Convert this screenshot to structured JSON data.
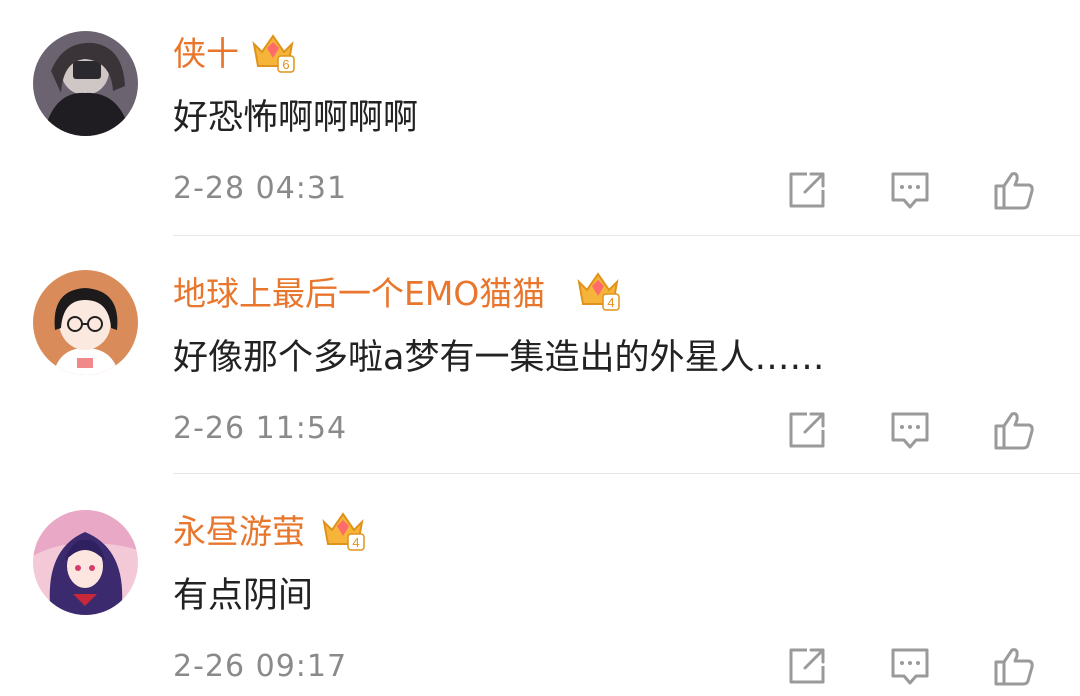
{
  "accent_color": "#e8762d",
  "comments": [
    {
      "username": "侠十",
      "badge_level": "6",
      "badge_icon": "crown-badge-icon",
      "content": "好恐怖啊啊啊啊",
      "timestamp": "2-28 04:31"
    },
    {
      "username": "地球上最后一个EMO猫猫",
      "badge_level": "4",
      "badge_icon": "crown-badge-icon",
      "content": "好像那个多啦a梦有一集造出的外星人……",
      "timestamp": "2-26 11:54"
    },
    {
      "username": "永昼游萤",
      "badge_level": "4",
      "badge_icon": "crown-badge-icon",
      "content": "有点阴间",
      "timestamp": "2-26 09:17"
    }
  ],
  "action_icons": [
    "share-icon",
    "reply-icon",
    "like-icon"
  ]
}
